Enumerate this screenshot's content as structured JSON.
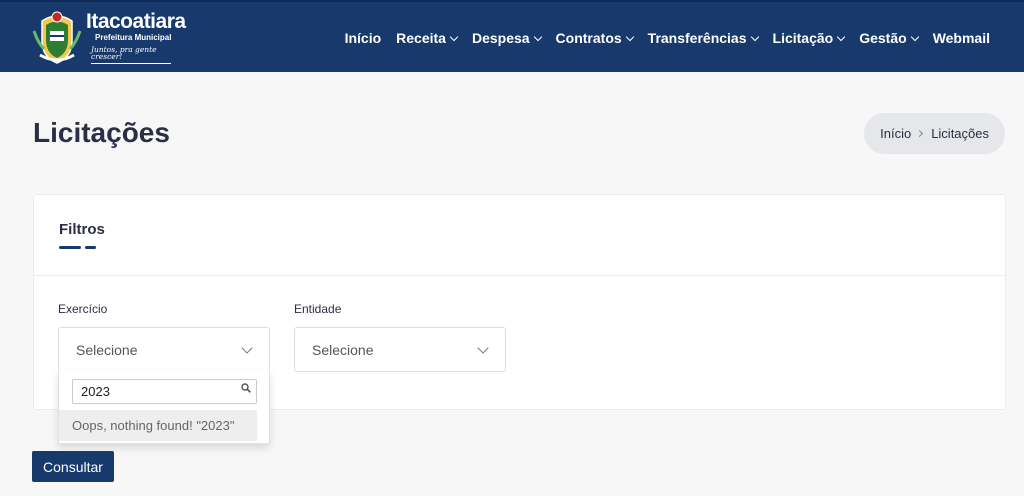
{
  "header": {
    "logo_name": "Itacoatiara",
    "logo_sub": "Prefeitura Municipal",
    "logo_slogan": "Juntos, pra gente crescer!",
    "nav": [
      {
        "label": "Início",
        "dropdown": false
      },
      {
        "label": "Receita",
        "dropdown": true
      },
      {
        "label": "Despesa",
        "dropdown": true
      },
      {
        "label": "Contratos",
        "dropdown": true
      },
      {
        "label": "Transferências",
        "dropdown": true
      },
      {
        "label": "Licitação",
        "dropdown": true
      },
      {
        "label": "Gestão",
        "dropdown": true
      },
      {
        "label": "Webmail",
        "dropdown": false
      }
    ]
  },
  "page": {
    "title": "Licitações",
    "breadcrumb": {
      "home": "Início",
      "current": "Licitações"
    }
  },
  "filters": {
    "title": "Filtros",
    "exercicio": {
      "label": "Exercício",
      "value": "Selecione"
    },
    "entidade": {
      "label": "Entidade",
      "value": "Selecione"
    },
    "dropdown": {
      "search_value": "2023",
      "empty_message": "Oops, nothing found! \"2023\""
    }
  },
  "actions": {
    "submit_label": "Consultar"
  },
  "colors": {
    "primary": "#17396b",
    "page_bg": "#f7f7f8",
    "breadcrumb_bg": "#e6e7ea"
  }
}
